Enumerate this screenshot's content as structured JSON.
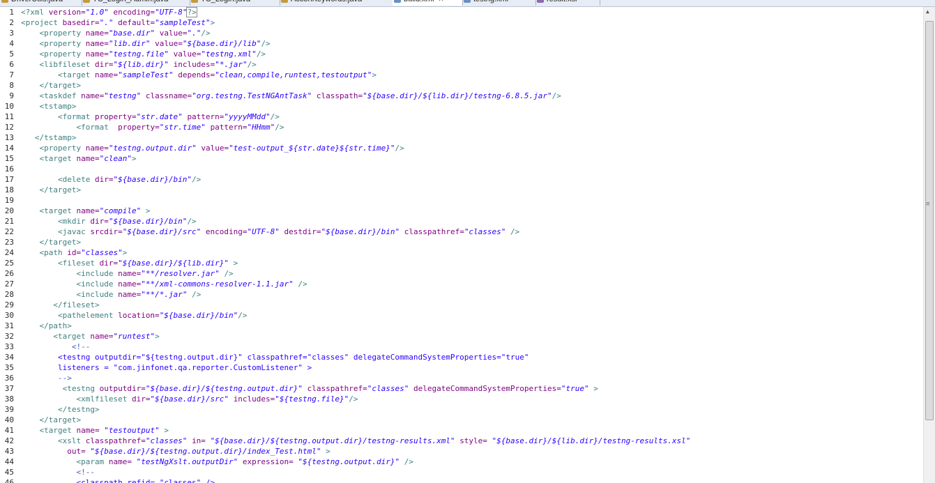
{
  "tabs": [
    {
      "label": "DriverUtils.java",
      "icon": "java-file-icon",
      "active": false
    },
    {
      "label": "TC_Login_Admin.java",
      "icon": "java-file-icon",
      "active": false
    },
    {
      "label": "TC_Login.java",
      "icon": "java-file-icon",
      "active": false
    },
    {
      "label": "ActionKeywords.java",
      "icon": "java-file-icon",
      "active": false
    },
    {
      "label": "build.xml",
      "icon": "xml-file-icon",
      "active": true
    },
    {
      "label": "testng.xml",
      "icon": "xml-file-icon",
      "active": false
    },
    {
      "label": "result.xsl",
      "icon": "xsl-file-icon",
      "active": false
    }
  ],
  "colors": {
    "tag": "#3f7f7f",
    "attribute": "#7f007f",
    "value": "#2a00ff",
    "comment": "#3f5fbf",
    "comment_text": "#2a00ff"
  },
  "lines": [
    {
      "n": "1",
      "segs": [
        [
          "t",
          "<?xml "
        ],
        [
          "a",
          "version="
        ],
        [
          "v",
          "\"1.0\""
        ],
        [
          "p",
          " "
        ],
        [
          "a",
          "encoding="
        ],
        [
          "v",
          "\"UTF-8\""
        ],
        [
          "t",
          "?>"
        ]
      ]
    },
    {
      "n": "2",
      "segs": [
        [
          "t",
          "<project "
        ],
        [
          "a",
          "basedir="
        ],
        [
          "v",
          "\".\""
        ],
        [
          "p",
          " "
        ],
        [
          "a",
          "default="
        ],
        [
          "v",
          "\"sampleTest\""
        ],
        [
          "t",
          ">"
        ]
      ]
    },
    {
      "n": "3",
      "segs": [
        [
          "p",
          "    "
        ],
        [
          "t",
          "<property "
        ],
        [
          "a",
          "name="
        ],
        [
          "v",
          "\"base.dir\""
        ],
        [
          "p",
          " "
        ],
        [
          "a",
          "value="
        ],
        [
          "v",
          "\".\""
        ],
        [
          "t",
          "/>"
        ]
      ]
    },
    {
      "n": "4",
      "segs": [
        [
          "p",
          "    "
        ],
        [
          "t",
          "<property "
        ],
        [
          "a",
          "name="
        ],
        [
          "v",
          "\"lib.dir\""
        ],
        [
          "p",
          " "
        ],
        [
          "a",
          "value="
        ],
        [
          "v",
          "\"${base.dir}/lib\""
        ],
        [
          "t",
          "/>"
        ]
      ]
    },
    {
      "n": "5",
      "segs": [
        [
          "p",
          "    "
        ],
        [
          "t",
          "<property "
        ],
        [
          "a",
          "name="
        ],
        [
          "v",
          "\"testng.file\""
        ],
        [
          "p",
          " "
        ],
        [
          "a",
          "value="
        ],
        [
          "v",
          "\"testng.xml\""
        ],
        [
          "t",
          "/>"
        ]
      ]
    },
    {
      "n": "6",
      "segs": [
        [
          "p",
          "    "
        ],
        [
          "t",
          "<libfileset "
        ],
        [
          "a",
          "dir="
        ],
        [
          "v",
          "\"${lib.dir}\""
        ],
        [
          "p",
          " "
        ],
        [
          "a",
          "includes="
        ],
        [
          "v",
          "\"*.jar\""
        ],
        [
          "t",
          "/>"
        ]
      ]
    },
    {
      "n": "7",
      "segs": [
        [
          "p",
          "        "
        ],
        [
          "t",
          "<target "
        ],
        [
          "a",
          "name="
        ],
        [
          "v",
          "\"sampleTest\""
        ],
        [
          "p",
          " "
        ],
        [
          "a",
          "depends="
        ],
        [
          "v",
          "\"clean,compile,runtest,testoutput\""
        ],
        [
          "t",
          ">"
        ]
      ]
    },
    {
      "n": "8",
      "segs": [
        [
          "p",
          "    "
        ],
        [
          "t",
          "</target>"
        ]
      ]
    },
    {
      "n": "9",
      "segs": [
        [
          "p",
          "    "
        ],
        [
          "t",
          "<taskdef "
        ],
        [
          "a",
          "name="
        ],
        [
          "v",
          "\"testng\""
        ],
        [
          "p",
          " "
        ],
        [
          "a",
          "classname="
        ],
        [
          "v",
          "\"org.testng.TestNGAntTask\""
        ],
        [
          "p",
          " "
        ],
        [
          "a",
          "classpath="
        ],
        [
          "v",
          "\"${base.dir}/${lib.dir}/testng-6.8.5.jar\""
        ],
        [
          "t",
          "/>"
        ]
      ]
    },
    {
      "n": "10",
      "segs": [
        [
          "p",
          "    "
        ],
        [
          "t",
          "<tstamp>"
        ]
      ]
    },
    {
      "n": "11",
      "segs": [
        [
          "p",
          "        "
        ],
        [
          "t",
          "<format "
        ],
        [
          "a",
          "property="
        ],
        [
          "v",
          "\"str.date\""
        ],
        [
          "p",
          " "
        ],
        [
          "a",
          "pattern="
        ],
        [
          "v",
          "\"yyyyMMdd\""
        ],
        [
          "t",
          "/>"
        ]
      ]
    },
    {
      "n": "12",
      "segs": [
        [
          "p",
          "            "
        ],
        [
          "t",
          "<format  "
        ],
        [
          "a",
          "property="
        ],
        [
          "v",
          "\"str.time\""
        ],
        [
          "p",
          " "
        ],
        [
          "a",
          "pattern="
        ],
        [
          "v",
          "\"HHmm\""
        ],
        [
          "t",
          "/>"
        ]
      ]
    },
    {
      "n": "13",
      "segs": [
        [
          "p",
          "   "
        ],
        [
          "t",
          "</tstamp>"
        ]
      ]
    },
    {
      "n": "14",
      "segs": [
        [
          "p",
          "    "
        ],
        [
          "t",
          "<property "
        ],
        [
          "a",
          "name="
        ],
        [
          "v",
          "\"testng.output.dir\""
        ],
        [
          "p",
          " "
        ],
        [
          "a",
          "value="
        ],
        [
          "v",
          "\"test-output_${str.date}${str.time}\""
        ],
        [
          "t",
          "/>"
        ]
      ]
    },
    {
      "n": "15",
      "segs": [
        [
          "p",
          "    "
        ],
        [
          "t",
          "<target "
        ],
        [
          "a",
          "name="
        ],
        [
          "v",
          "\"clean\""
        ],
        [
          "t",
          ">"
        ]
      ]
    },
    {
      "n": "16",
      "segs": []
    },
    {
      "n": "17",
      "segs": [
        [
          "p",
          "        "
        ],
        [
          "t",
          "<delete "
        ],
        [
          "a",
          "dir="
        ],
        [
          "v",
          "\"${base.dir}/bin\""
        ],
        [
          "t",
          "/>"
        ]
      ]
    },
    {
      "n": "18",
      "segs": [
        [
          "p",
          "    "
        ],
        [
          "t",
          "</target>"
        ]
      ]
    },
    {
      "n": "19",
      "segs": []
    },
    {
      "n": "20",
      "segs": [
        [
          "p",
          "    "
        ],
        [
          "t",
          "<target "
        ],
        [
          "a",
          "name="
        ],
        [
          "v",
          "\"compile\""
        ],
        [
          "p",
          " "
        ],
        [
          "t",
          ">"
        ]
      ]
    },
    {
      "n": "21",
      "segs": [
        [
          "p",
          "        "
        ],
        [
          "t",
          "<mkdir "
        ],
        [
          "a",
          "dir="
        ],
        [
          "v",
          "\"${base.dir}/bin\""
        ],
        [
          "t",
          "/>"
        ]
      ]
    },
    {
      "n": "22",
      "segs": [
        [
          "p",
          "        "
        ],
        [
          "t",
          "<javac "
        ],
        [
          "a",
          "srcdir="
        ],
        [
          "v",
          "\"${base.dir}/src\""
        ],
        [
          "p",
          " "
        ],
        [
          "a",
          "encoding="
        ],
        [
          "v",
          "\"UTF-8\""
        ],
        [
          "p",
          " "
        ],
        [
          "a",
          "destdir="
        ],
        [
          "v",
          "\"${base.dir}/bin\""
        ],
        [
          "p",
          " "
        ],
        [
          "a",
          "classpathref="
        ],
        [
          "v",
          "\"classes\""
        ],
        [
          "p",
          " "
        ],
        [
          "t",
          "/>"
        ]
      ]
    },
    {
      "n": "23",
      "segs": [
        [
          "p",
          "    "
        ],
        [
          "t",
          "</target>"
        ]
      ]
    },
    {
      "n": "24",
      "segs": [
        [
          "p",
          "    "
        ],
        [
          "t",
          "<path "
        ],
        [
          "a",
          "id="
        ],
        [
          "v",
          "\"classes\""
        ],
        [
          "t",
          ">"
        ]
      ]
    },
    {
      "n": "25",
      "segs": [
        [
          "p",
          "        "
        ],
        [
          "t",
          "<fileset "
        ],
        [
          "a",
          "dir="
        ],
        [
          "v",
          "\"${base.dir}/${lib.dir}\""
        ],
        [
          "p",
          " "
        ],
        [
          "t",
          ">"
        ]
      ]
    },
    {
      "n": "26",
      "segs": [
        [
          "p",
          "            "
        ],
        [
          "t",
          "<include "
        ],
        [
          "a",
          "name="
        ],
        [
          "v",
          "\"**/resolver.jar\""
        ],
        [
          "p",
          " "
        ],
        [
          "t",
          "/>"
        ]
      ]
    },
    {
      "n": "27",
      "segs": [
        [
          "p",
          "            "
        ],
        [
          "t",
          "<include "
        ],
        [
          "a",
          "name="
        ],
        [
          "v",
          "\"**/xml-commons-resolver-1.1.jar\""
        ],
        [
          "p",
          " "
        ],
        [
          "t",
          "/>"
        ]
      ]
    },
    {
      "n": "28",
      "segs": [
        [
          "p",
          "            "
        ],
        [
          "t",
          "<include "
        ],
        [
          "a",
          "name="
        ],
        [
          "v",
          "\"**/*.jar\""
        ],
        [
          "p",
          " "
        ],
        [
          "t",
          "/>"
        ]
      ]
    },
    {
      "n": "29",
      "segs": [
        [
          "p",
          "       "
        ],
        [
          "t",
          "</fileset>"
        ]
      ]
    },
    {
      "n": "30",
      "segs": [
        [
          "p",
          "        "
        ],
        [
          "t",
          "<pathelement "
        ],
        [
          "a",
          "location="
        ],
        [
          "v",
          "\"${base.dir}/bin\""
        ],
        [
          "t",
          "/>"
        ]
      ]
    },
    {
      "n": "31",
      "segs": [
        [
          "p",
          "    "
        ],
        [
          "t",
          "</path>"
        ]
      ]
    },
    {
      "n": "32",
      "segs": [
        [
          "p",
          "       "
        ],
        [
          "t",
          "<target "
        ],
        [
          "a",
          "name="
        ],
        [
          "v",
          "\"runtest\""
        ],
        [
          "t",
          ">"
        ]
      ]
    },
    {
      "n": "33",
      "segs": [
        [
          "p",
          "           "
        ],
        [
          "c",
          "<!--"
        ]
      ]
    },
    {
      "n": "34",
      "segs": [
        [
          "p",
          "        "
        ],
        [
          "x",
          "<testng outputdir=\"${testng.output.dir}\" classpathref=\"classes\" delegateCommandSystemProperties=\"true\""
        ]
      ]
    },
    {
      "n": "35",
      "segs": [
        [
          "p",
          "        "
        ],
        [
          "x",
          "listeners = \"com.jinfonet.qa.reporter.CustomListener\" >"
        ]
      ]
    },
    {
      "n": "36",
      "segs": [
        [
          "p",
          "        "
        ],
        [
          "c",
          "-->"
        ]
      ]
    },
    {
      "n": "37",
      "segs": [
        [
          "p",
          "         "
        ],
        [
          "t",
          "<testng "
        ],
        [
          "a",
          "outputdir="
        ],
        [
          "v",
          "\"${base.dir}/${testng.output.dir}\""
        ],
        [
          "p",
          " "
        ],
        [
          "a",
          "classpathref="
        ],
        [
          "v",
          "\"classes\""
        ],
        [
          "p",
          " "
        ],
        [
          "a",
          "delegateCommandSystemProperties="
        ],
        [
          "v",
          "\"true\""
        ],
        [
          "p",
          " "
        ],
        [
          "t",
          ">"
        ]
      ]
    },
    {
      "n": "38",
      "segs": [
        [
          "p",
          "            "
        ],
        [
          "t",
          "<xmlfileset "
        ],
        [
          "a",
          "dir="
        ],
        [
          "v",
          "\"${base.dir}/src\""
        ],
        [
          "p",
          " "
        ],
        [
          "a",
          "includes="
        ],
        [
          "v",
          "\"${testng.file}\""
        ],
        [
          "t",
          "/>"
        ]
      ]
    },
    {
      "n": "39",
      "segs": [
        [
          "p",
          "        "
        ],
        [
          "t",
          "</testng>"
        ]
      ]
    },
    {
      "n": "40",
      "segs": [
        [
          "p",
          "    "
        ],
        [
          "t",
          "</target>"
        ]
      ]
    },
    {
      "n": "41",
      "segs": [
        [
          "p",
          "    "
        ],
        [
          "t",
          "<target "
        ],
        [
          "a",
          "name= "
        ],
        [
          "v",
          "\"testoutput\""
        ],
        [
          "p",
          " "
        ],
        [
          "t",
          ">"
        ]
      ]
    },
    {
      "n": "42",
      "segs": [
        [
          "p",
          "        "
        ],
        [
          "t",
          "<xslt "
        ],
        [
          "a",
          "classpathref="
        ],
        [
          "v",
          "\"classes\""
        ],
        [
          "p",
          " "
        ],
        [
          "a",
          "in= "
        ],
        [
          "v",
          "\"${base.dir}/${testng.output.dir}/testng-results.xml\""
        ],
        [
          "p",
          " "
        ],
        [
          "a",
          "style= "
        ],
        [
          "v",
          "\"${base.dir}/${lib.dir}/testng-results.xsl\""
        ]
      ]
    },
    {
      "n": "43",
      "segs": [
        [
          "p",
          "          "
        ],
        [
          "a",
          "out= "
        ],
        [
          "v",
          "\"${base.dir}/${testng.output.dir}/index_Test.html\""
        ],
        [
          "p",
          " "
        ],
        [
          "t",
          ">"
        ]
      ]
    },
    {
      "n": "44",
      "segs": [
        [
          "p",
          "            "
        ],
        [
          "t",
          "<param "
        ],
        [
          "a",
          "name= "
        ],
        [
          "v",
          "\"testNgXslt.outputDir\""
        ],
        [
          "p",
          " "
        ],
        [
          "a",
          "expression= "
        ],
        [
          "v",
          "\"${testng.output.dir}\""
        ],
        [
          "p",
          " "
        ],
        [
          "t",
          "/>"
        ]
      ]
    },
    {
      "n": "45",
      "segs": [
        [
          "p",
          "            "
        ],
        [
          "c",
          "<!--"
        ]
      ]
    },
    {
      "n": "46",
      "segs": [
        [
          "p",
          "            "
        ],
        [
          "x",
          "<classpath refid= \"classes\" />"
        ]
      ]
    }
  ]
}
